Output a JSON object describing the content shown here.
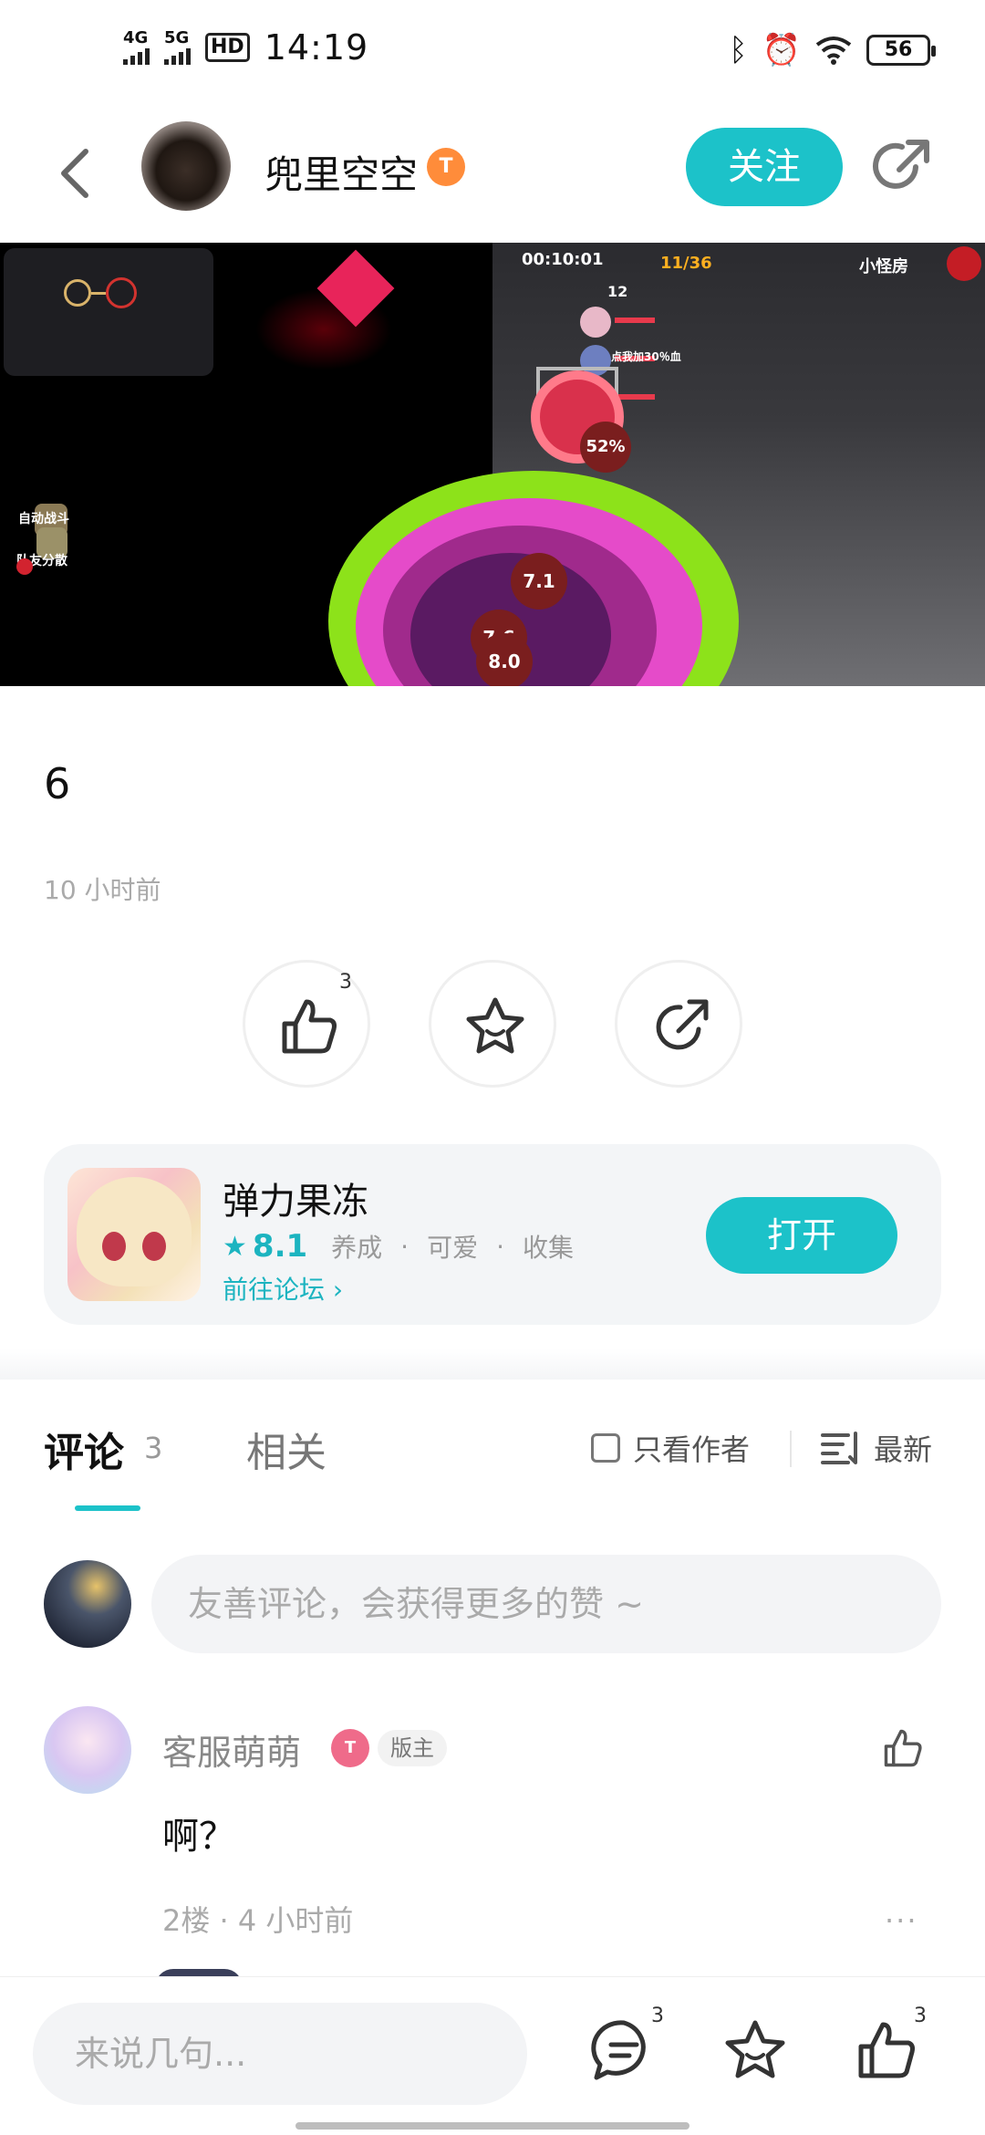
{
  "status_bar": {
    "net1": "4G",
    "net2": "5G",
    "hd": "HD",
    "time": "14:19",
    "battery": "56"
  },
  "header": {
    "author_name": "兜里空空",
    "level_badge": "T",
    "follow_label": "关注"
  },
  "post": {
    "text": "6",
    "time": "10 小时前",
    "like_count": "3"
  },
  "game_overlay": {
    "timer": "00:10:01",
    "wave": "11/36",
    "room_label": "小怪房",
    "auto_battle": "自动战斗",
    "team_split": "队友分散",
    "hp_count": "12",
    "bonus_text": "点我加30％血",
    "balls": [
      "7.1",
      "7.6",
      "8.0"
    ],
    "percent": "52%"
  },
  "app_card": {
    "name": "弹力果冻",
    "rating": "8.1",
    "tags": [
      "养成",
      "可爱",
      "收集"
    ],
    "forum_link": "前往论坛 ›",
    "open_label": "打开"
  },
  "comments_section": {
    "tab_comments": "评论",
    "comments_count": "3",
    "tab_related": "相关",
    "author_only_label": "只看作者",
    "sort_label": "最新",
    "input_placeholder": "友善评论，会获得更多的赞 ~"
  },
  "comments": [
    {
      "user": "客服萌萌",
      "badge": "T",
      "role": "版主",
      "body": "啊？",
      "floor": "2楼",
      "time": "4 小时前",
      "more": "···"
    }
  ],
  "bottom_bar": {
    "reply_placeholder": "来说几句...",
    "comment_count": "3",
    "like_count": "3"
  },
  "colors": {
    "accent": "#1cc2c9",
    "level_badge": "#ff8c3a",
    "mod_badge": "#ef6b8a"
  }
}
